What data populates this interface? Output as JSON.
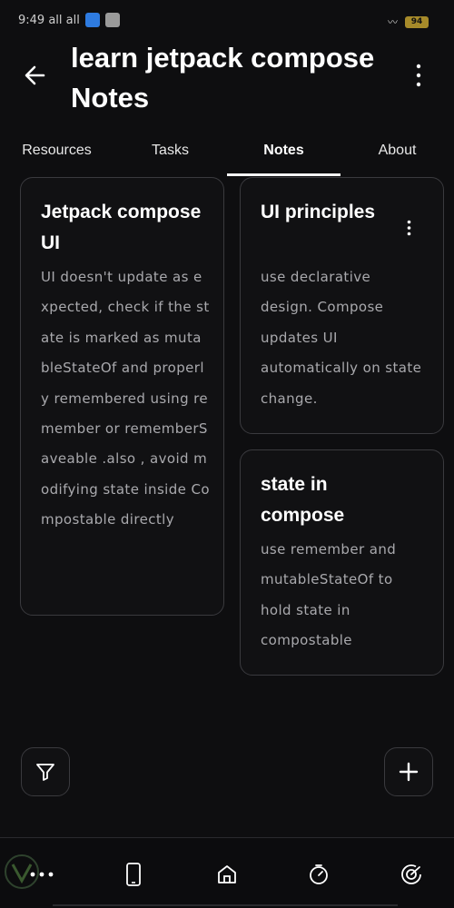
{
  "status_bar": {
    "left_text": "9:49 all all",
    "battery": "94"
  },
  "header": {
    "title": "learn jetpack compose Notes"
  },
  "tabs": [
    {
      "label": "Resources",
      "active": false
    },
    {
      "label": "Tasks",
      "active": false
    },
    {
      "label": "Notes",
      "active": true
    },
    {
      "label": "About",
      "active": false
    }
  ],
  "notes": [
    {
      "title": "Jetpack compose UI",
      "body": "UI doesn't update as expected, check if the state is marked as mutableStateOf and properly remembered using remember or rememberSaveable .also , avoid modifying state inside Compostable directly"
    },
    {
      "title": "UI principles",
      "body": "use declarative design. Compose updates UI automatically on state change."
    },
    {
      "title": "state in compose",
      "body": "use remember and mutableStateOf to hold state in compostable"
    }
  ],
  "icons": {
    "back": "arrow-left-icon",
    "more": "more-vertical-icon",
    "filter": "filter-icon",
    "add": "plus-icon",
    "nav": [
      "menu-dots-icon",
      "phone-icon",
      "home-icon",
      "timer-icon",
      "radar-icon"
    ]
  },
  "colors": {
    "background": "#0e0e10",
    "card_border": "#3a3a3e",
    "body_text": "#a9a9ad"
  }
}
